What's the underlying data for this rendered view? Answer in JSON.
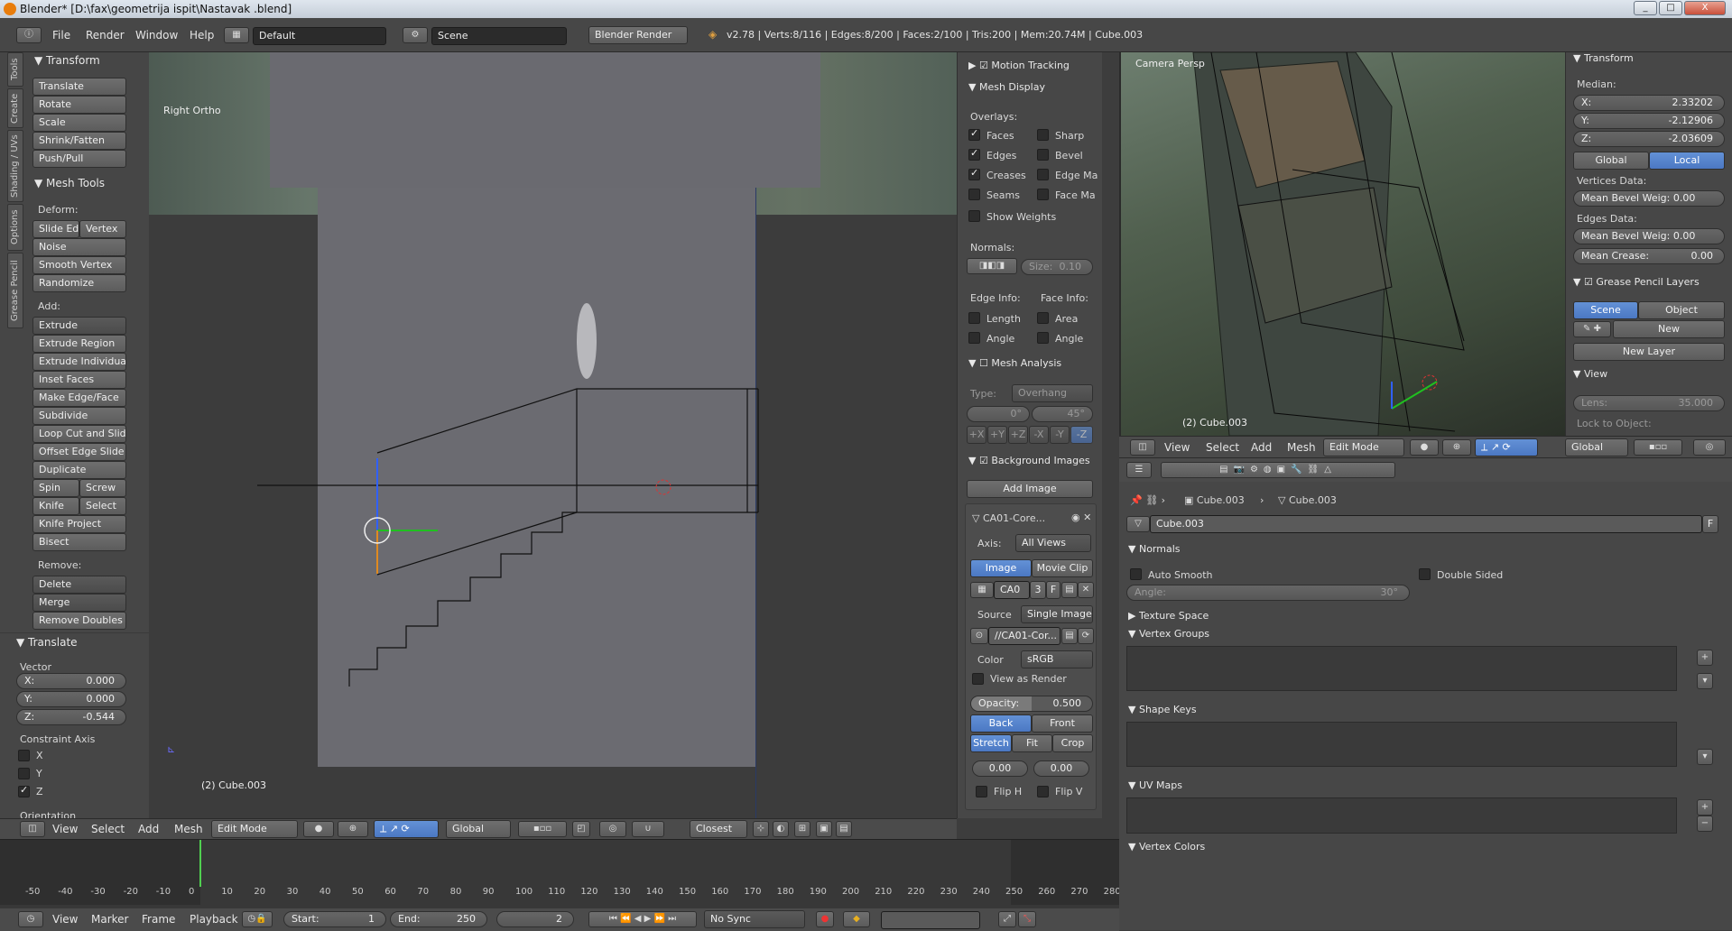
{
  "window": {
    "title": "Blender* [D:\\fax\\geometrija ispit\\Nastavak .blend]",
    "min": "_",
    "max": "□",
    "close": "X"
  },
  "info": {
    "menus": [
      "File",
      "Render",
      "Window",
      "Help"
    ],
    "layout": "Default",
    "scene": "Scene",
    "engine": "Blender Render",
    "stats": "v2.78 | Verts:8/116 | Edges:8/200 | Faces:2/100 | Tris:200 | Mem:20.74M | Cube.003"
  },
  "toolshelf": {
    "tabs": [
      "Tools",
      "Create",
      "Shading / UVs",
      "Options",
      "Grease Pencil"
    ],
    "transform": {
      "title": "Transform",
      "buttons": [
        "Translate",
        "Rotate",
        "Scale",
        "Shrink/Fatten",
        "Push/Pull"
      ]
    },
    "mesh_tools": {
      "title": "Mesh Tools",
      "deform_label": "Deform:",
      "slide_edge": "Slide Ed",
      "vertex": "Vertex",
      "noise": "Noise",
      "smooth_vertex": "Smooth Vertex",
      "randomize": "Randomize",
      "add_label": "Add:",
      "extrude": "Extrude",
      "extrude_region": "Extrude Region",
      "extrude_individual": "Extrude Individual",
      "inset_faces": "Inset Faces",
      "make_edge_face": "Make Edge/Face",
      "subdivide": "Subdivide",
      "loop_cut": "Loop Cut and Slide",
      "offset_edge": "Offset Edge Slide",
      "duplicate": "Duplicate",
      "spin": "Spin",
      "screw": "Screw",
      "knife": "Knife",
      "select": "Select",
      "knife_project": "Knife Project",
      "bisect": "Bisect",
      "remove_label": "Remove:",
      "delete": "Delete",
      "merge": "Merge",
      "remove_doubles": "Remove Doubles"
    },
    "operator": {
      "title": "Translate",
      "vector_label": "Vector",
      "x_label": "X:",
      "x": "0.000",
      "y_label": "Y:",
      "y": "0.000",
      "z_label": "Z:",
      "z": "-0.544",
      "constraint_label": "Constraint Axis",
      "axes": [
        "X",
        "Y",
        "Z"
      ],
      "axes_checked": [
        false,
        false,
        true
      ],
      "orientation_label": "Orientation"
    }
  },
  "viewport_left": {
    "label": "Right Ortho",
    "object": "(2) Cube.003",
    "header": {
      "menus": [
        "View",
        "Select",
        "Add",
        "Mesh"
      ],
      "mode": "Edit Mode",
      "orientation": "Global",
      "snap": "Closest"
    }
  },
  "properties_n": {
    "motion_tracking": "Motion Tracking",
    "mesh_display": "Mesh Display",
    "overlays_label": "Overlays:",
    "overlays": [
      {
        "label": "Faces",
        "on": true
      },
      {
        "label": "Sharp",
        "on": false
      },
      {
        "label": "Edges",
        "on": true
      },
      {
        "label": "Bevel",
        "on": false
      },
      {
        "label": "Creases",
        "on": true
      },
      {
        "label": "Edge Ma",
        "on": false
      },
      {
        "label": "Seams",
        "on": false
      },
      {
        "label": "Face Ma",
        "on": false
      }
    ],
    "show_weights": "Show Weights",
    "normals_label": "Normals:",
    "size": "Size:",
    "size_value": "0.10",
    "edge_info": "Edge Info:",
    "face_info": "Face Info:",
    "length": "Length",
    "area": "Area",
    "angle": "Angle",
    "mesh_analysis": "Mesh Analysis",
    "type_label": "Type:",
    "type_value": "Overhang",
    "min_deg": "0°",
    "max_deg": "45°",
    "axes": [
      "+X",
      "+Y",
      "+Z",
      "-X",
      "-Y",
      "-Z"
    ],
    "background_images": "Background Images",
    "add_image": "Add Image",
    "bg_name": "CA01-Core...",
    "axis_label": "Axis:",
    "axis_value": "All Views",
    "image": "Image",
    "movie_clip": "Movie Clip",
    "img_name": "CA0",
    "img_users": "3",
    "img_f": "F",
    "source_label": "Source",
    "source_value": "Single Image",
    "path": "//CA01-Cor...",
    "color_label": "Color",
    "color_value": "sRGB",
    "view_as_render": "View as Render",
    "opacity_label": "Opacity:",
    "opacity_value": "0.500",
    "back": "Back",
    "front": "Front",
    "stretch": "Stretch",
    "fit": "Fit",
    "crop": "Crop",
    "off_x": "0.00",
    "off_y": "0.00",
    "flip_h": "Flip H",
    "flip_v": "Flip V"
  },
  "viewport_right": {
    "label": "Camera Persp",
    "object": "(2) Cube.003",
    "header": {
      "menus": [
        "View",
        "Select",
        "Add",
        "Mesh"
      ],
      "mode": "Edit Mode",
      "orientation": "Global"
    }
  },
  "n_panel_right": {
    "transform": "Transform",
    "median": "Median:",
    "x_label": "X:",
    "x": "2.33202",
    "y_label": "Y:",
    "y": "-2.12906",
    "z_label": "Z:",
    "z": "-2.03609",
    "global": "Global",
    "local": "Local",
    "vertices_data": "Vertices Data:",
    "mean_bevel_v": "Mean Bevel Weig: 0.00",
    "edges_data": "Edges Data:",
    "mean_bevel_e": "Mean Bevel Weig: 0.00",
    "mean_crease": "Mean Crease:",
    "mean_crease_value": "0.00",
    "grease_pencil": "Grease Pencil Layers",
    "scene": "Scene",
    "object": "Object",
    "new": "New",
    "new_layer": "New Layer",
    "view": "View",
    "lens": "Lens:",
    "lens_value": "35.000",
    "lock": "Lock to Object:"
  },
  "mesh_props": {
    "obj": "Cube.003",
    "mesh": "Cube.003",
    "datablock": "Cube.003",
    "f": "F",
    "normals": "Normals",
    "auto_smooth": "Auto Smooth",
    "double_sided": "Double Sided",
    "angle": "Angle:",
    "angle_value": "30°",
    "texture_space": "Texture Space",
    "vertex_groups": "Vertex Groups",
    "shape_keys": "Shape Keys",
    "uv_maps": "UV Maps",
    "vertex_colors": "Vertex Colors"
  },
  "timeline": {
    "ticks": [
      "-50",
      "-40",
      "-30",
      "-20",
      "-10",
      "0",
      "10",
      "20",
      "30",
      "40",
      "50",
      "60",
      "70",
      "80",
      "90",
      "100",
      "110",
      "120",
      "130",
      "140",
      "150",
      "160",
      "170",
      "180",
      "190",
      "200",
      "210",
      "220",
      "230",
      "240",
      "250",
      "260",
      "270",
      "280"
    ],
    "menus": [
      "View",
      "Marker",
      "Frame",
      "Playback"
    ],
    "start_label": "Start:",
    "start": "1",
    "end_label": "End:",
    "end": "250",
    "current": "2",
    "sync": "No Sync"
  }
}
